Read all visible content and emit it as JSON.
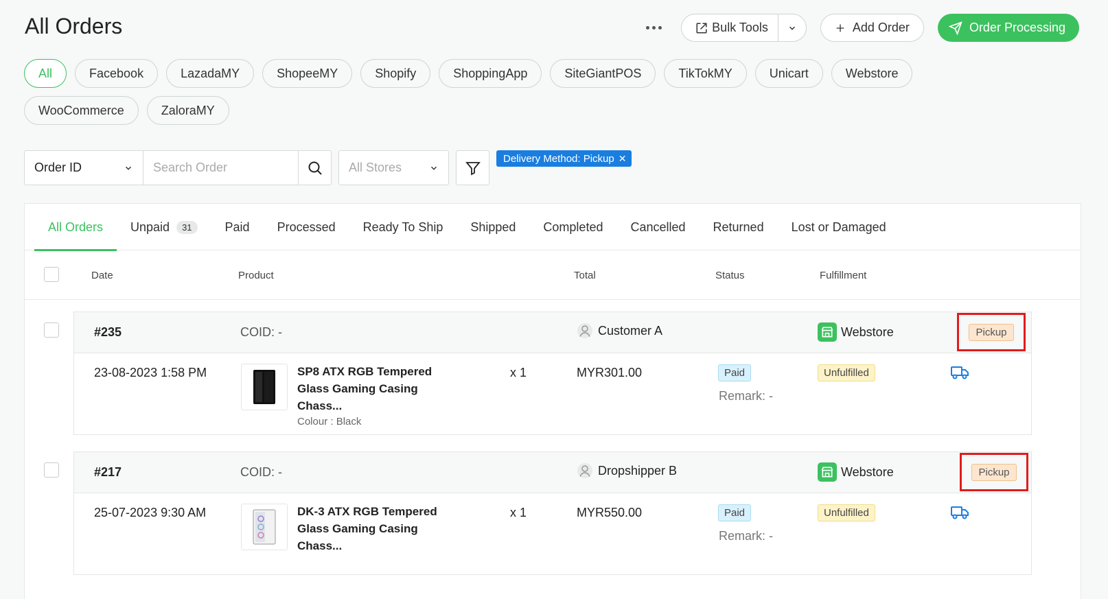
{
  "header": {
    "title": "All Orders",
    "bulk_tools_label": "Bulk Tools",
    "add_order_label": "Add Order",
    "order_processing_label": "Order Processing"
  },
  "channels": [
    "All",
    "Facebook",
    "LazadaMY",
    "ShopeeMY",
    "Shopify",
    "ShoppingApp",
    "SiteGiantPOS",
    "TikTokMY",
    "Unicart",
    "Webstore",
    "WooCommerce",
    "ZaloraMY"
  ],
  "search": {
    "type_label": "Order ID",
    "placeholder": "Search Order",
    "store_label": "All Stores"
  },
  "active_filter": "Delivery Method: Pickup",
  "tabs": {
    "all_orders": "All Orders",
    "unpaid": "Unpaid",
    "unpaid_count": "31",
    "paid": "Paid",
    "processed": "Processed",
    "ready_to_ship": "Ready To Ship",
    "shipped": "Shipped",
    "completed": "Completed",
    "cancelled": "Cancelled",
    "returned": "Returned",
    "lost_or_damaged": "Lost or Damaged"
  },
  "columns": {
    "date": "Date",
    "product": "Product",
    "total": "Total",
    "status": "Status",
    "fulfillment": "Fulfillment"
  },
  "orders": [
    {
      "id": "#235",
      "coid": "COID: -",
      "customer": "Customer A",
      "store": "Webstore",
      "delivery": "Pickup",
      "date": "23-08-2023 1:58 PM",
      "product_name": "SP8 ATX RGB Tempered Glass Gaming Casing Chass...",
      "variant": "Colour : Black",
      "qty": "x 1",
      "total": "MYR301.00",
      "payment_status": "Paid",
      "remark": "Remark: -",
      "fulfillment_status": "Unfulfilled",
      "colors": {
        "thumb_body": "#111111"
      }
    },
    {
      "id": "#217",
      "coid": "COID: -",
      "customer": "Dropshipper B",
      "store": "Webstore",
      "delivery": "Pickup",
      "date": "25-07-2023 9:30 AM",
      "product_name": "DK-3 ATX RGB Tempered Glass Gaming Casing Chass...",
      "variant": "",
      "qty": "x 1",
      "total": "MYR550.00",
      "payment_status": "Paid",
      "remark": "Remark: -",
      "fulfillment_status": "Unfulfilled",
      "colors": {
        "thumb_body": "#f2f2f2"
      }
    }
  ],
  "colors": {
    "accent": "#3cc15f",
    "filter_tag": "#1a7ee0",
    "highlight_box": "#e11b1b",
    "truck_icon": "#1a7ee0"
  }
}
